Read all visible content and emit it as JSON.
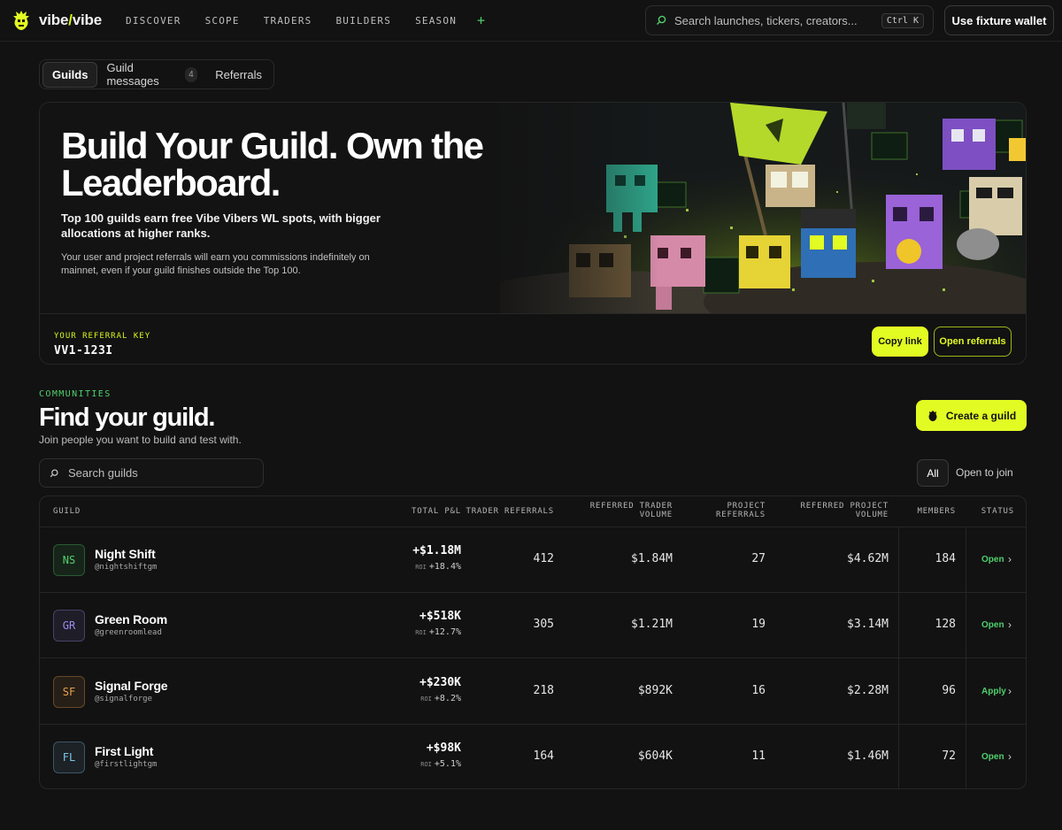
{
  "app": {
    "logo_prefix": "vibe",
    "logo_slash": "/",
    "logo_suffix": "vibe"
  },
  "nav": {
    "items": [
      "DISCOVER",
      "SCOPE",
      "TRADERS",
      "BUILDERS",
      "SEASON"
    ],
    "plus": "+"
  },
  "search": {
    "placeholder": "Search launches, tickers, creators...",
    "shortcut": "Ctrl K"
  },
  "wallet_button": "Use fixture wallet",
  "tabs": [
    {
      "label": "Guilds",
      "active": true
    },
    {
      "label": "Guild messages",
      "count": "4"
    },
    {
      "label": "Referrals"
    }
  ],
  "hero": {
    "title": "Build Your Guild. Own the Leaderboard.",
    "lead": "Top 100 guilds earn free Vibe Vibers WL spots, with bigger allocations at higher ranks.",
    "sub": "Your user and project referrals will earn you commissions indefinitely on mainnet, even if your guild finishes outside the Top 100.",
    "referral_label": "YOUR REFERRAL KEY",
    "referral_key": "VV1-123I",
    "copy_button": "Copy link",
    "open_button": "Open referrals"
  },
  "communities": {
    "eyebrow": "COMMUNITIES",
    "title": "Find your guild.",
    "description": "Join people you want to build and test with.",
    "create_button": "Create a guild",
    "search_placeholder": "Search guilds",
    "filter_all": "All",
    "filter_open": "Open to join"
  },
  "table": {
    "headers": {
      "guild": "GUILD",
      "pnl": "TOTAL P&L",
      "trader_ref": "TRADER REFERRALS",
      "ref_trader_vol_1": "REFERRED TRADER",
      "ref_trader_vol_2": "VOLUME",
      "proj_ref_1": "PROJECT",
      "proj_ref_2": "REFERRALS",
      "ref_proj_vol_1": "REFERRED PROJECT",
      "ref_proj_vol_2": "VOLUME",
      "members": "MEMBERS",
      "status": "STATUS"
    },
    "roi_label": "ROI",
    "rows": [
      {
        "initials": "NS",
        "name": "Night Shift",
        "handle": "@nightshiftgm",
        "pnl": "+$1.18M",
        "roi": "+18.4%",
        "trader_ref": "412",
        "trader_vol": "$1.84M",
        "proj_ref": "27",
        "proj_vol": "$4.62M",
        "members": "184",
        "status": "Open",
        "color": "#4fd06d"
      },
      {
        "initials": "GR",
        "name": "Green Room",
        "handle": "@greenroomlead",
        "pnl": "+$518K",
        "roi": "+12.7%",
        "trader_ref": "305",
        "trader_vol": "$1.21M",
        "proj_ref": "19",
        "proj_vol": "$3.14M",
        "members": "128",
        "status": "Open",
        "color": "#9d8cf0"
      },
      {
        "initials": "SF",
        "name": "Signal Forge",
        "handle": "@signalforge",
        "pnl": "+$230K",
        "roi": "+8.2%",
        "trader_ref": "218",
        "trader_vol": "$892K",
        "proj_ref": "16",
        "proj_vol": "$2.28M",
        "members": "96",
        "status": "Apply",
        "color": "#e7a04e"
      },
      {
        "initials": "FL",
        "name": "First Light",
        "handle": "@firstlightgm",
        "pnl": "+$98K",
        "roi": "+5.1%",
        "trader_ref": "164",
        "trader_vol": "$604K",
        "proj_ref": "11",
        "proj_vol": "$1.46M",
        "members": "72",
        "status": "Open",
        "color": "#7cc4e8"
      }
    ]
  },
  "colors": {
    "accent_lime": "#e2fb23",
    "accent_green": "#4fd06d",
    "background": "#121212"
  }
}
